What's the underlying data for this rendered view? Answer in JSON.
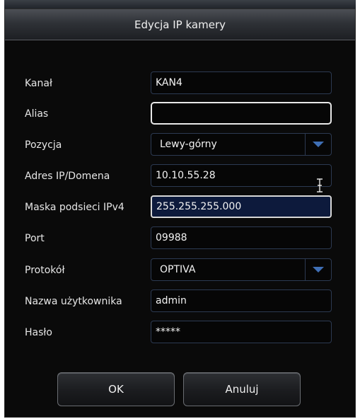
{
  "dialog": {
    "title": "Edycja IP kamery"
  },
  "fields": {
    "channel": {
      "label": "Kanał",
      "value": "KAN4"
    },
    "alias": {
      "label": "Alias",
      "value": ""
    },
    "position": {
      "label": "Pozycja",
      "value": "Lewy-górny"
    },
    "ip": {
      "label": "Adres IP/Domena",
      "value": "10.10.55.28"
    },
    "mask": {
      "label": "Maska podsieci IPv4",
      "value": "255.255.255.000"
    },
    "port": {
      "label": "Port",
      "value": "09988"
    },
    "protocol": {
      "label": "Protokół",
      "value": "OPTIVA"
    },
    "username": {
      "label": "Nazwa użytkownika",
      "value": "admin"
    },
    "password": {
      "label": "Hasło",
      "value": "*****"
    }
  },
  "buttons": {
    "ok": "OK",
    "cancel": "Anuluj"
  },
  "colors": {
    "accent": "#3f6fb5",
    "background": "#0a0a0a",
    "field_border": "#2c3a52"
  }
}
